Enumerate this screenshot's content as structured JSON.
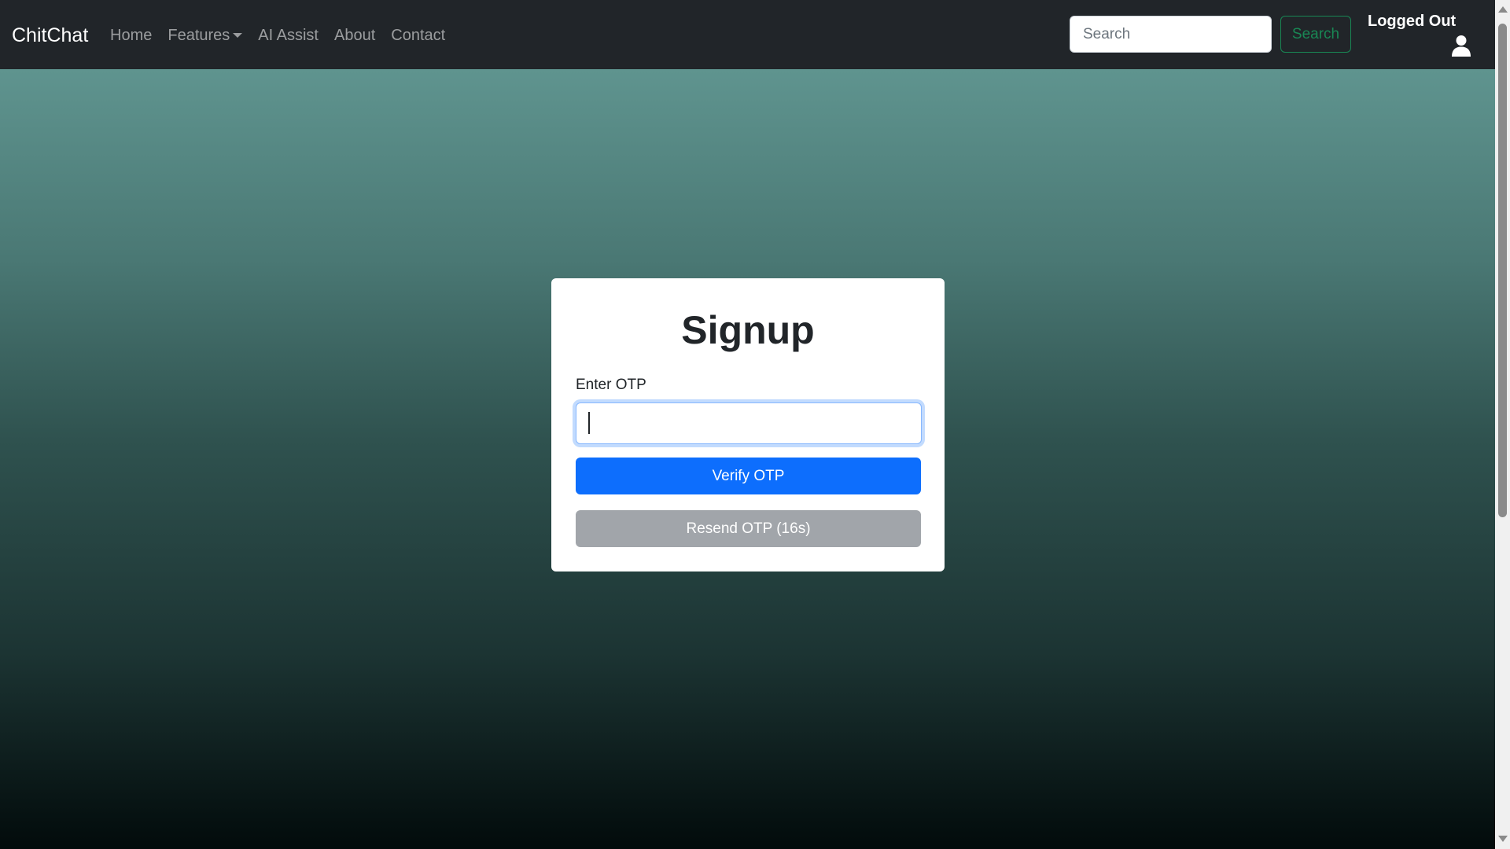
{
  "navbar": {
    "brand": "ChitChat",
    "links": [
      {
        "label": "Home"
      },
      {
        "label": "Features"
      },
      {
        "label": "AI Assist"
      },
      {
        "label": "About"
      },
      {
        "label": "Contact"
      }
    ],
    "search": {
      "placeholder": "Search",
      "button_label": "Search"
    },
    "login_status": "Logged Out",
    "user_icon": "user-icon"
  },
  "card": {
    "title": "Signup",
    "otp_label": "Enter OTP",
    "otp_value": "",
    "verify_button": "Verify OTP",
    "resend_button": "Resend OTP (16s)"
  },
  "colors": {
    "navbar": "#212529",
    "primary": "#0d6efd",
    "success": "#198754",
    "disabled": "#a1a5aa"
  }
}
